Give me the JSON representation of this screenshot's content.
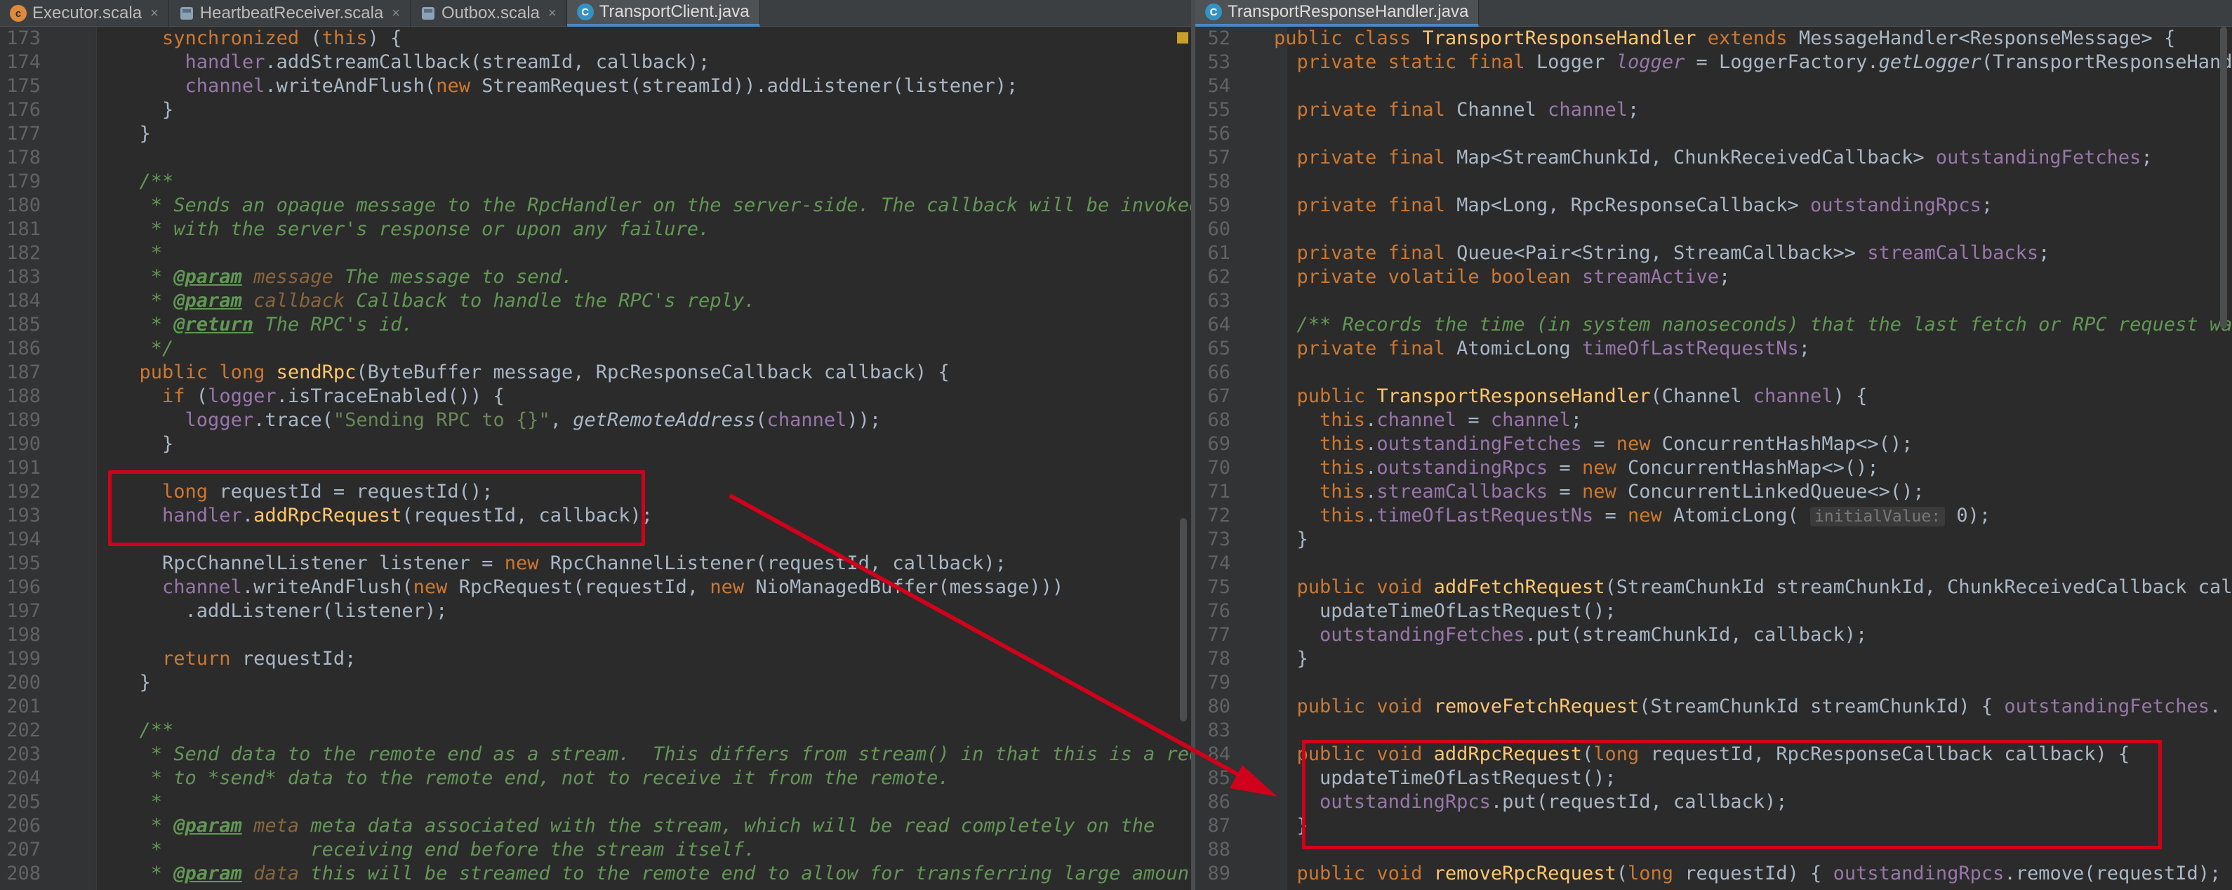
{
  "left_tabs": [
    {
      "name": "Executor.scala",
      "icon": "scala-class-icon"
    },
    {
      "name": "HeartbeatReceiver.scala",
      "icon": "scala-object-icon"
    },
    {
      "name": "Outbox.scala",
      "icon": "scala-object-icon"
    },
    {
      "name": "TransportClient.java",
      "icon": "java-class-icon",
      "active": true
    }
  ],
  "right_tab": {
    "name": "TransportResponseHandler.java",
    "icon": "java-class-icon"
  },
  "left_code": [
    {
      "n": "173",
      "t": "    synchronized (this) {"
    },
    {
      "n": "174",
      "t": "      handler.addStreamCallback(streamId, callback);"
    },
    {
      "n": "175",
      "t": "      channel.writeAndFlush(new StreamRequest(streamId)).addListener(listener);"
    },
    {
      "n": "176",
      "t": "    }"
    },
    {
      "n": "177",
      "t": "  }"
    },
    {
      "n": "178",
      "t": ""
    },
    {
      "n": "179",
      "t": "  /**"
    },
    {
      "n": "180",
      "t": "   * Sends an opaque message to the RpcHandler on the server-side. The callback will be invoked"
    },
    {
      "n": "181",
      "t": "   * with the server's response or upon any failure."
    },
    {
      "n": "182",
      "t": "   *"
    },
    {
      "n": "183",
      "t": "   * @param message The message to send."
    },
    {
      "n": "184",
      "t": "   * @param callback Callback to handle the RPC's reply."
    },
    {
      "n": "185",
      "t": "   * @return The RPC's id."
    },
    {
      "n": "186",
      "t": "   */"
    },
    {
      "n": "187",
      "t": "  public long sendRpc(ByteBuffer message, RpcResponseCallback callback) {"
    },
    {
      "n": "188",
      "t": "    if (logger.isTraceEnabled()) {"
    },
    {
      "n": "189",
      "t": "      logger.trace(\"Sending RPC to {}\", getRemoteAddress(channel));"
    },
    {
      "n": "190",
      "t": "    }"
    },
    {
      "n": "191",
      "t": ""
    },
    {
      "n": "192",
      "t": "    long requestId = requestId();"
    },
    {
      "n": "193",
      "t": "    handler.addRpcRequest(requestId, callback);"
    },
    {
      "n": "194",
      "t": ""
    },
    {
      "n": "195",
      "t": "    RpcChannelListener listener = new RpcChannelListener(requestId, callback);"
    },
    {
      "n": "196",
      "t": "    channel.writeAndFlush(new RpcRequest(requestId, new NioManagedBuffer(message)))"
    },
    {
      "n": "197",
      "t": "      .addListener(listener);"
    },
    {
      "n": "198",
      "t": ""
    },
    {
      "n": "199",
      "t": "    return requestId;"
    },
    {
      "n": "200",
      "t": "  }"
    },
    {
      "n": "201",
      "t": ""
    },
    {
      "n": "202",
      "t": "  /**"
    },
    {
      "n": "203",
      "t": "   * Send data to the remote end as a stream.  This differs from stream() in that this is a reques"
    },
    {
      "n": "204",
      "t": "   * to *send* data to the remote end, not to receive it from the remote."
    },
    {
      "n": "205",
      "t": "   *"
    },
    {
      "n": "206",
      "t": "   * @param meta meta data associated with the stream, which will be read completely on the"
    },
    {
      "n": "207",
      "t": "   *             receiving end before the stream itself."
    },
    {
      "n": "208",
      "t": "   * @param data this will be streamed to the remote end to allow for transferring large amounts"
    }
  ],
  "right_code": [
    {
      "n": "52",
      "t": "public class TransportResponseHandler extends MessageHandler<ResponseMessage> {"
    },
    {
      "n": "53",
      "t": "  private static final Logger logger = LoggerFactory.getLogger(TransportResponseHand"
    },
    {
      "n": "54",
      "t": ""
    },
    {
      "n": "55",
      "t": "  private final Channel channel;"
    },
    {
      "n": "56",
      "t": ""
    },
    {
      "n": "57",
      "t": "  private final Map<StreamChunkId, ChunkReceivedCallback> outstandingFetches;"
    },
    {
      "n": "58",
      "t": ""
    },
    {
      "n": "59",
      "t": "  private final Map<Long, RpcResponseCallback> outstandingRpcs;"
    },
    {
      "n": "60",
      "t": ""
    },
    {
      "n": "61",
      "t": "  private final Queue<Pair<String, StreamCallback>> streamCallbacks;"
    },
    {
      "n": "62",
      "t": "  private volatile boolean streamActive;"
    },
    {
      "n": "63",
      "t": ""
    },
    {
      "n": "64",
      "t": "  /** Records the time (in system nanoseconds) that the last fetch or RPC request wa"
    },
    {
      "n": "65",
      "t": "  private final AtomicLong timeOfLastRequestNs;"
    },
    {
      "n": "66",
      "t": ""
    },
    {
      "n": "67",
      "t": "  public TransportResponseHandler(Channel channel) {"
    },
    {
      "n": "68",
      "t": "    this.channel = channel;"
    },
    {
      "n": "69",
      "t": "    this.outstandingFetches = new ConcurrentHashMap<>();"
    },
    {
      "n": "70",
      "t": "    this.outstandingRpcs = new ConcurrentHashMap<>();"
    },
    {
      "n": "71",
      "t": "    this.streamCallbacks = new ConcurrentLinkedQueue<>();"
    },
    {
      "n": "72",
      "t": "    this.timeOfLastRequestNs = new AtomicLong( initialValue: 0);"
    },
    {
      "n": "73",
      "t": "  }"
    },
    {
      "n": "74",
      "t": ""
    },
    {
      "n": "75",
      "t": "  public void addFetchRequest(StreamChunkId streamChunkId, ChunkReceivedCallback cal"
    },
    {
      "n": "76",
      "t": "    updateTimeOfLastRequest();"
    },
    {
      "n": "77",
      "t": "    outstandingFetches.put(streamChunkId, callback);"
    },
    {
      "n": "78",
      "t": "  }"
    },
    {
      "n": "79",
      "t": ""
    },
    {
      "n": "80",
      "t": "  public void removeFetchRequest(StreamChunkId streamChunkId) { outstandingFetches."
    },
    {
      "n": "83",
      "t": ""
    },
    {
      "n": "84",
      "t": "  public void addRpcRequest(long requestId, RpcResponseCallback callback) {"
    },
    {
      "n": "85",
      "t": "    updateTimeOfLastRequest();"
    },
    {
      "n": "86",
      "t": "    outstandingRpcs.put(requestId, callback);"
    },
    {
      "n": "87",
      "t": "  }"
    },
    {
      "n": "88",
      "t": ""
    },
    {
      "n": "89",
      "t": "  public void removeRpcRequest(long requestId) { outstandingRpcs.remove(requestId);"
    }
  ],
  "colors": {
    "background": "#2b2b2b",
    "keyword": "#cc7832",
    "field": "#9876aa",
    "method": "#ffc66d",
    "string": "#6a8759",
    "doc_comment": "#629755",
    "highlight_box": "#d0021b"
  }
}
